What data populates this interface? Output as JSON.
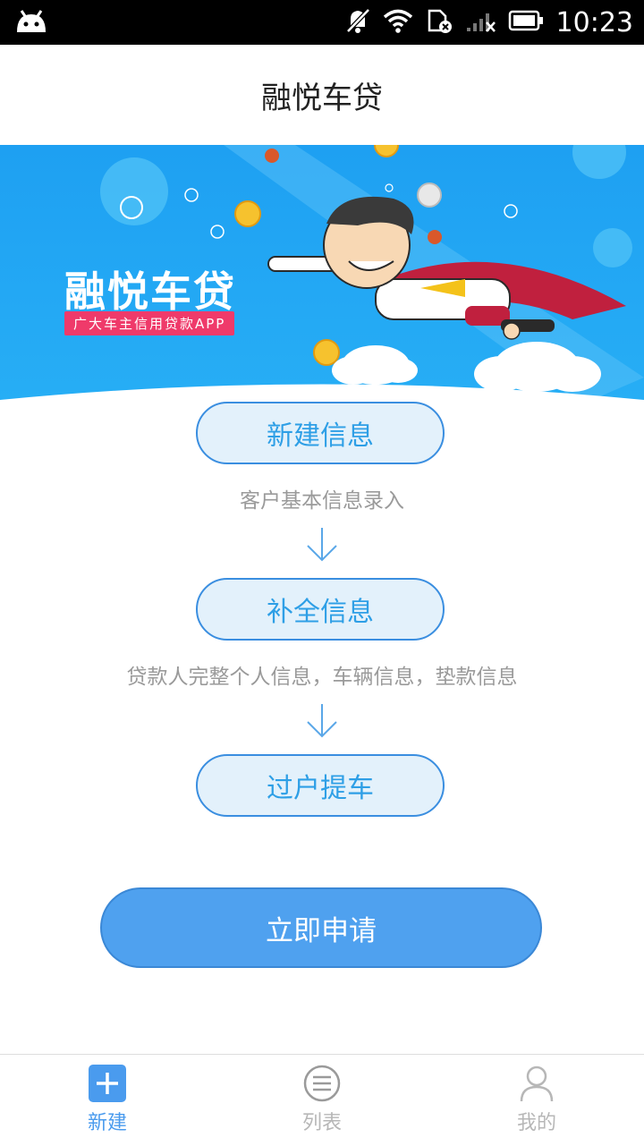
{
  "status_bar": {
    "time": "10:23",
    "icons": [
      "android-icon",
      "notifications-off-icon",
      "wifi-icon",
      "sim-error-icon",
      "signal-icon",
      "battery-icon"
    ]
  },
  "header": {
    "title": "融悦车贷"
  },
  "banner": {
    "title": "融悦车贷",
    "subtitle": "广大车主信用贷款APP"
  },
  "steps": [
    {
      "label": "新建信息",
      "description": "客户基本信息录入"
    },
    {
      "label": "补全信息",
      "description": "贷款人完整个人信息，车辆信息，垫款信息"
    },
    {
      "label": "过户提车",
      "description": ""
    }
  ],
  "apply_label": "立即申请",
  "bottom_nav": [
    {
      "label": "新建",
      "icon": "plus-icon",
      "active": true
    },
    {
      "label": "列表",
      "icon": "list-icon",
      "active": false
    },
    {
      "label": "我的",
      "icon": "profile-icon",
      "active": false
    }
  ],
  "colors": {
    "accent": "#4fa1ef",
    "step_text": "#2e9fe6",
    "banner_bg": "#20a4f3",
    "badge": "#ef3a6a"
  }
}
